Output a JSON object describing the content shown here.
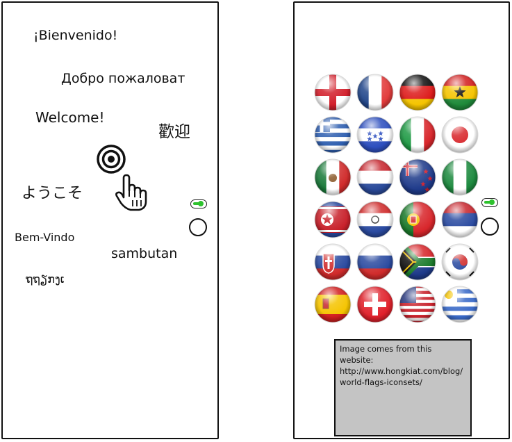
{
  "left_panel": {
    "greetings": [
      {
        "id": "es",
        "text": "¡Bienvenido!"
      },
      {
        "id": "ru",
        "text": "Добро пожаловат"
      },
      {
        "id": "en",
        "text": "Welcome!"
      },
      {
        "id": "zh",
        "text": "歡迎"
      },
      {
        "id": "ja",
        "text": "ようこそ"
      },
      {
        "id": "pt",
        "text": "Bem-Vindo"
      },
      {
        "id": "tl",
        "text": "sambutan"
      },
      {
        "id": "km",
        "text": "ຖຖຽກງເ"
      }
    ],
    "icons": [
      "target-icon",
      "pointing-hand-icon"
    ]
  },
  "right_panel": {
    "flags": [
      "england",
      "france",
      "germany",
      "ghana",
      "greece",
      "honduras",
      "italy",
      "japan",
      "mexico",
      "netherlands",
      "new-zealand",
      "nigeria",
      "north-korea",
      "paraguay",
      "portugal",
      "serbia",
      "slovakia",
      "slovenia",
      "south-africa",
      "south-korea",
      "spain",
      "switzerland",
      "usa",
      "uruguay"
    ],
    "source_note": {
      "line1": "Image comes from this",
      "line2": "website:",
      "line3": "http://www.hongkiat.com/blog/",
      "line4": "world-flags-iconsets/"
    }
  },
  "colors": {
    "toggle_on": "#2ec22e",
    "note_background": "#c4c4c4"
  }
}
